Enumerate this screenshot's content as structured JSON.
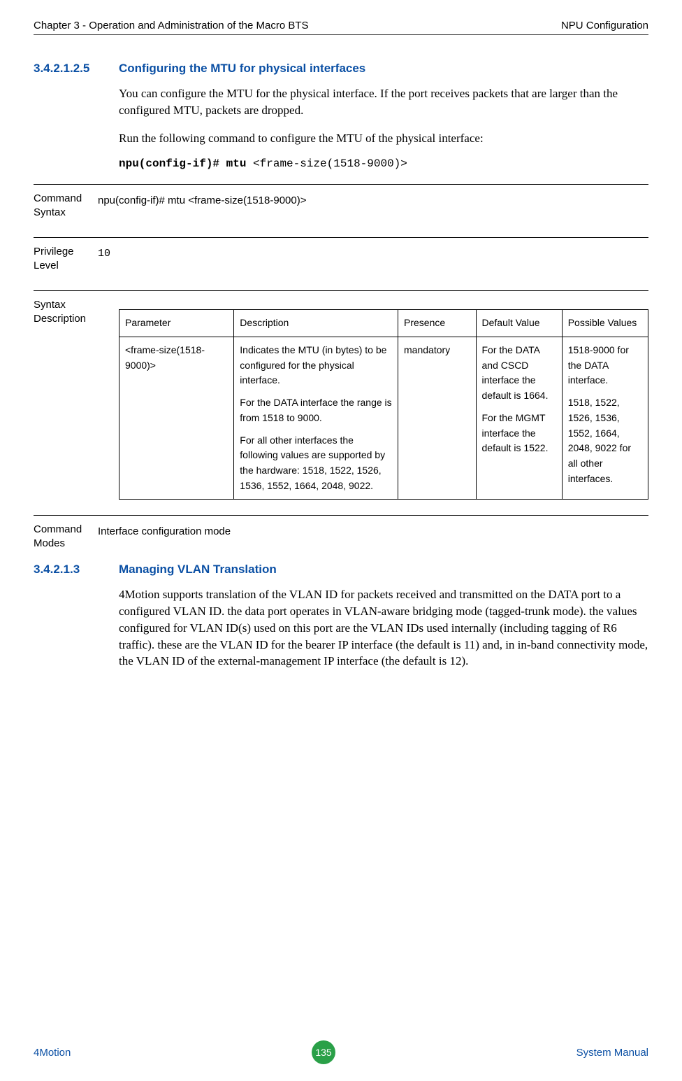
{
  "header": {
    "left": "Chapter 3 - Operation and Administration of the Macro BTS",
    "right": "NPU Configuration"
  },
  "section1": {
    "num": "3.4.2.1.2.5",
    "title": "Configuring the MTU for physical interfaces",
    "p1": "You can configure the MTU for the physical interface. If the port receives packets that are larger than the configured MTU, packets are dropped.",
    "p2": "Run the following command to configure the MTU of the physical interface:",
    "cmd_bold": "npu(config-if)# mtu",
    "cmd_rest": " <frame-size(1518-9000)>"
  },
  "defs": {
    "command_syntax_label": "Command Syntax",
    "command_syntax_value": "npu(config-if)# mtu <frame-size(1518-9000)>",
    "privilege_label": "Privilege Level",
    "privilege_value": "10",
    "syntax_label": "Syntax Description",
    "command_modes_label": "Command Modes",
    "command_modes_value": "Interface configuration mode"
  },
  "table": {
    "head": {
      "parameter": "Parameter",
      "description": "Description",
      "presence": "Presence",
      "default": "Default Value",
      "possible": "Possible Values"
    },
    "row": {
      "parameter": "<frame-size(1518-9000)>",
      "desc_p1": "Indicates the MTU (in bytes) to be configured for the physical interface.",
      "desc_p2": "For the DATA interface the range is from 1518 to 9000.",
      "desc_p3": "For all other interfaces the following values are supported by the hardware: 1518, 1522, 1526, 1536, 1552, 1664, 2048, 9022.",
      "presence": "mandatory",
      "default_p1": "For the DATA and CSCD interface the default is 1664.",
      "default_p2": "For the MGMT interface the default is 1522.",
      "possible_p1": "1518-9000 for the DATA interface.",
      "possible_p2": "1518, 1522, 1526, 1536, 1552, 1664, 2048, 9022 for all other interfaces."
    }
  },
  "section2": {
    "num": "3.4.2.1.3",
    "title": "Managing VLAN Translation",
    "p1": "4Motion supports translation of the VLAN ID for packets received and transmitted on the DATA port to a configured VLAN ID. the data port operates in VLAN-aware bridging mode (tagged-trunk mode). the values configured for VLAN ID(s) used on this port are the VLAN IDs used internally (including tagging of R6 traffic). these are the VLAN ID for the bearer IP interface (the default is 11) and, in in-band connectivity mode, the VLAN ID of the external-management IP interface (the default is 12)."
  },
  "footer": {
    "left": "4Motion",
    "page": "135",
    "right": "System Manual"
  }
}
